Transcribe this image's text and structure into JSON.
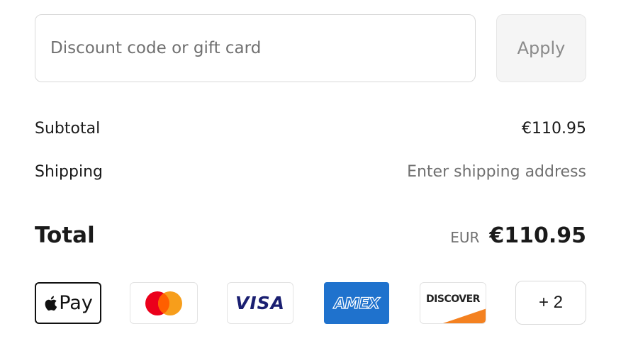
{
  "discount": {
    "placeholder": "Discount code or gift card",
    "value": "",
    "apply_label": "Apply"
  },
  "summary": {
    "subtotal_label": "Subtotal",
    "subtotal_value": "€110.95",
    "shipping_label": "Shipping",
    "shipping_value": "Enter shipping address",
    "total_label": "Total",
    "total_currency": "EUR",
    "total_value": "€110.95"
  },
  "payment_methods": {
    "apple_pay_label": "Pay",
    "visa_label": "VISA",
    "amex_label": "AMEX",
    "discover_label": "DISCOVER",
    "more_label": "+ 2",
    "icons": [
      "apple-pay-icon",
      "mastercard-icon",
      "visa-icon",
      "amex-icon",
      "discover-icon"
    ],
    "colors": {
      "mastercard_red": "#eb001b",
      "mastercard_orange": "#f79e1b",
      "visa_blue": "#1a1f71",
      "amex_blue": "#1f72cd",
      "discover_orange": "#f48120"
    }
  }
}
